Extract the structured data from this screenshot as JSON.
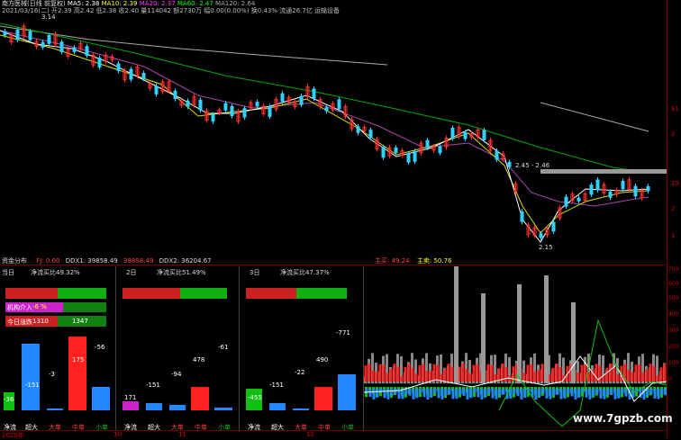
{
  "header": {
    "line1_prefix": "南方医械(日线 前复权)",
    "ma5": "MA5: 2.38",
    "ma10": "MA10: 2.39",
    "ma20": "MA20: 2.37",
    "ma60": "MA60: 2.47",
    "ma120": "MA120: 2.64",
    "line2": "2021/03/16(二) 开2.39 高2.42 低2.38 收2.40 量114042 额2730万 幅0.00(0.00%) 换0.43% 流通26.7亿 运输设备"
  },
  "price_chart": {
    "high_label": "3.14",
    "low_label": "2.15",
    "mid_label": "2.45 - 2.46",
    "right_ticks": [
      "81",
      "2",
      "19",
      "2",
      "1"
    ]
  },
  "fund_header": {
    "title": "资金分布",
    "fj": "FJ: 0.00",
    "ddx1": "DDX1: 39858.49",
    "ddx1b": "39858.49",
    "ddx2": "DDX2: 36204.67",
    "main_in": "主买: 49.24",
    "main_sell": "主卖: 50.76"
  },
  "panels": [
    {
      "title": "当日",
      "net_ratio": "净流买比49.32%",
      "inst_label": "机构介入",
      "inst_value": "-6 %",
      "today_label": "今日涨跌",
      "today_left": "1310",
      "today_right": "1347",
      "bars": [
        {
          "label": "净流",
          "value": "-36"
        },
        {
          "label": "超大",
          "value": "-151"
        },
        {
          "label": "大单",
          "value": "-3"
        },
        {
          "label": "中单",
          "value": "175"
        },
        {
          "label": "小单",
          "value": "-56"
        }
      ]
    },
    {
      "title": "2日",
      "net_ratio": "净流买比51.49%",
      "bars": [
        {
          "label": "净流",
          "value": "171"
        },
        {
          "label": "超大",
          "value": "-151"
        },
        {
          "label": "大单",
          "value": "-94"
        },
        {
          "label": "中单",
          "value": "478"
        },
        {
          "label": "小单",
          "value": "-61"
        }
      ]
    },
    {
      "title": "3日",
      "net_ratio": "净流买比47.37%",
      "bars": [
        {
          "label": "净流",
          "value": "-455"
        },
        {
          "label": "超大",
          "value": "-151"
        },
        {
          "label": "大单",
          "value": "-22"
        },
        {
          "label": "中单",
          "value": "490"
        },
        {
          "label": "小单",
          "value": "-771"
        }
      ]
    }
  ],
  "fund_right_ticks": [
    "700",
    "600",
    "500",
    "400",
    "300",
    "200",
    "100",
    "0"
  ],
  "x_axis": {
    "year": "2020年",
    "m1": "10",
    "m2": "11",
    "m3": "12"
  },
  "watermark": "www.7gpzb.com",
  "colors": {
    "red": "#ff2020",
    "green": "#00cc00",
    "blue": "#2288ff",
    "magenta": "#cc33cc",
    "yellow": "#ffff00"
  }
}
